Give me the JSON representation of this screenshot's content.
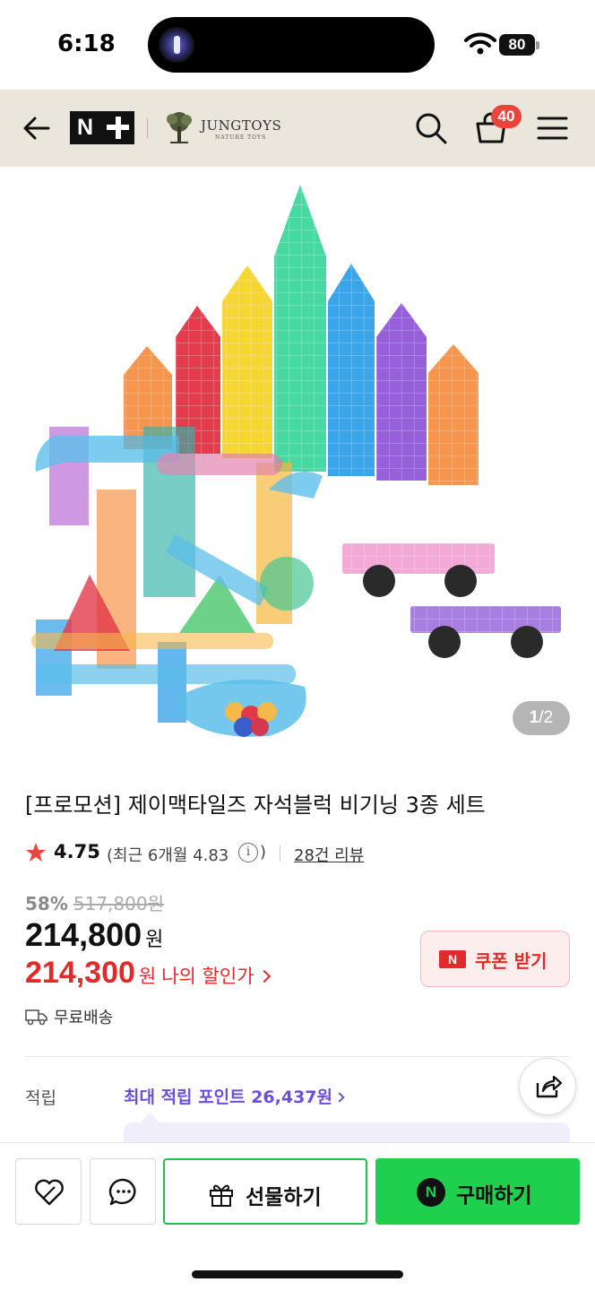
{
  "status_bar": {
    "time": "6:18",
    "battery": "80"
  },
  "header": {
    "nplus_logo_text": "N",
    "brand_name": "JUNGTOYS",
    "brand_tagline": "NATURE TOYS",
    "cart_count": "40",
    "icons": [
      "back-arrow-icon",
      "search-icon",
      "cart-icon",
      "menu-icon"
    ]
  },
  "gallery": {
    "current": "1",
    "separator": "/",
    "total": "2"
  },
  "product": {
    "title": "[프로모션] 제이맥타일즈 자석블럭 비기닝 3종 세트",
    "rating": "4.75",
    "recent_rating_text": "(최근 6개월 4.83",
    "recent_rating_close": ")",
    "info_glyph": "i",
    "review_link": "28건 리뷰",
    "discount_rate": "58%",
    "original_price": "517,800원",
    "price": "214,800",
    "price_unit": "원",
    "my_price": "214,300",
    "my_price_unit": "원",
    "my_price_label": "나의 할인가",
    "coupon_button": "쿠폰 받기",
    "coupon_icon_text": "N",
    "shipping": "무료배송"
  },
  "points": {
    "label": "적립",
    "value": "최대 적립 포인트 26,437원"
  },
  "bottom_bar": {
    "gift_label": "선물하기",
    "buy_label": "구매하기",
    "buy_icon_text": "N"
  },
  "colors": {
    "header_bg": "#ebe6dc",
    "accent_red": "#e12a2a",
    "points_purple": "#6b4fd8",
    "buy_green": "#1fd04f"
  }
}
